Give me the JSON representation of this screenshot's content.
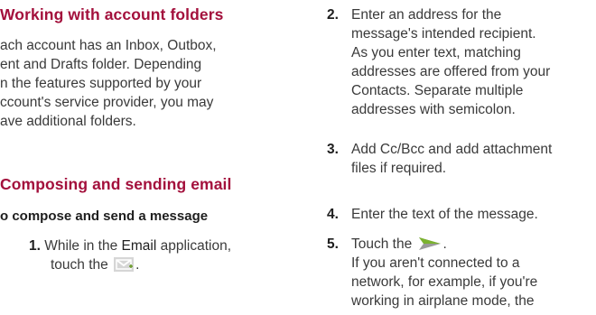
{
  "left": {
    "heading1": "Working with account folders",
    "para1_lines": [
      "ach account has an Inbox, Outbox,",
      "ent and Drafts folder. Depending",
      "n the features supported by your",
      "ccount's service provider, you may",
      "ave additional folders."
    ],
    "heading2": "Composing and sending email",
    "subhead": "o compose and send a message",
    "step1": {
      "num": "1.",
      "pre": "While in the ",
      "app": "Email",
      "post": " application,",
      "line2_pre": "touch the",
      "line2_post": "."
    }
  },
  "right": {
    "steps": [
      {
        "num": "2.",
        "lines": [
          "Enter an address for the",
          "message's intended recipient.",
          "As you enter text, matching",
          "addresses are offered from your",
          "Contacts. Separate multiple",
          "addresses with semicolon."
        ]
      },
      {
        "num": "3.",
        "lines": [
          "Add Cc/Bcc and add attachment",
          "files if required."
        ]
      },
      {
        "num": "4.",
        "lines": [
          "Enter the text of the message."
        ]
      },
      {
        "num": "5.",
        "line1_pre": "Touch the",
        "line1_post": ".",
        "lines": [
          "If you aren't connected to a",
          "network, for example, if you're",
          "working in airplane mode, the"
        ]
      }
    ]
  },
  "icons": {
    "compose": "compose-email-icon",
    "send": "send-arrow-icon"
  },
  "colors": {
    "heading": "#a3103c",
    "body": "#3a3a3a"
  }
}
